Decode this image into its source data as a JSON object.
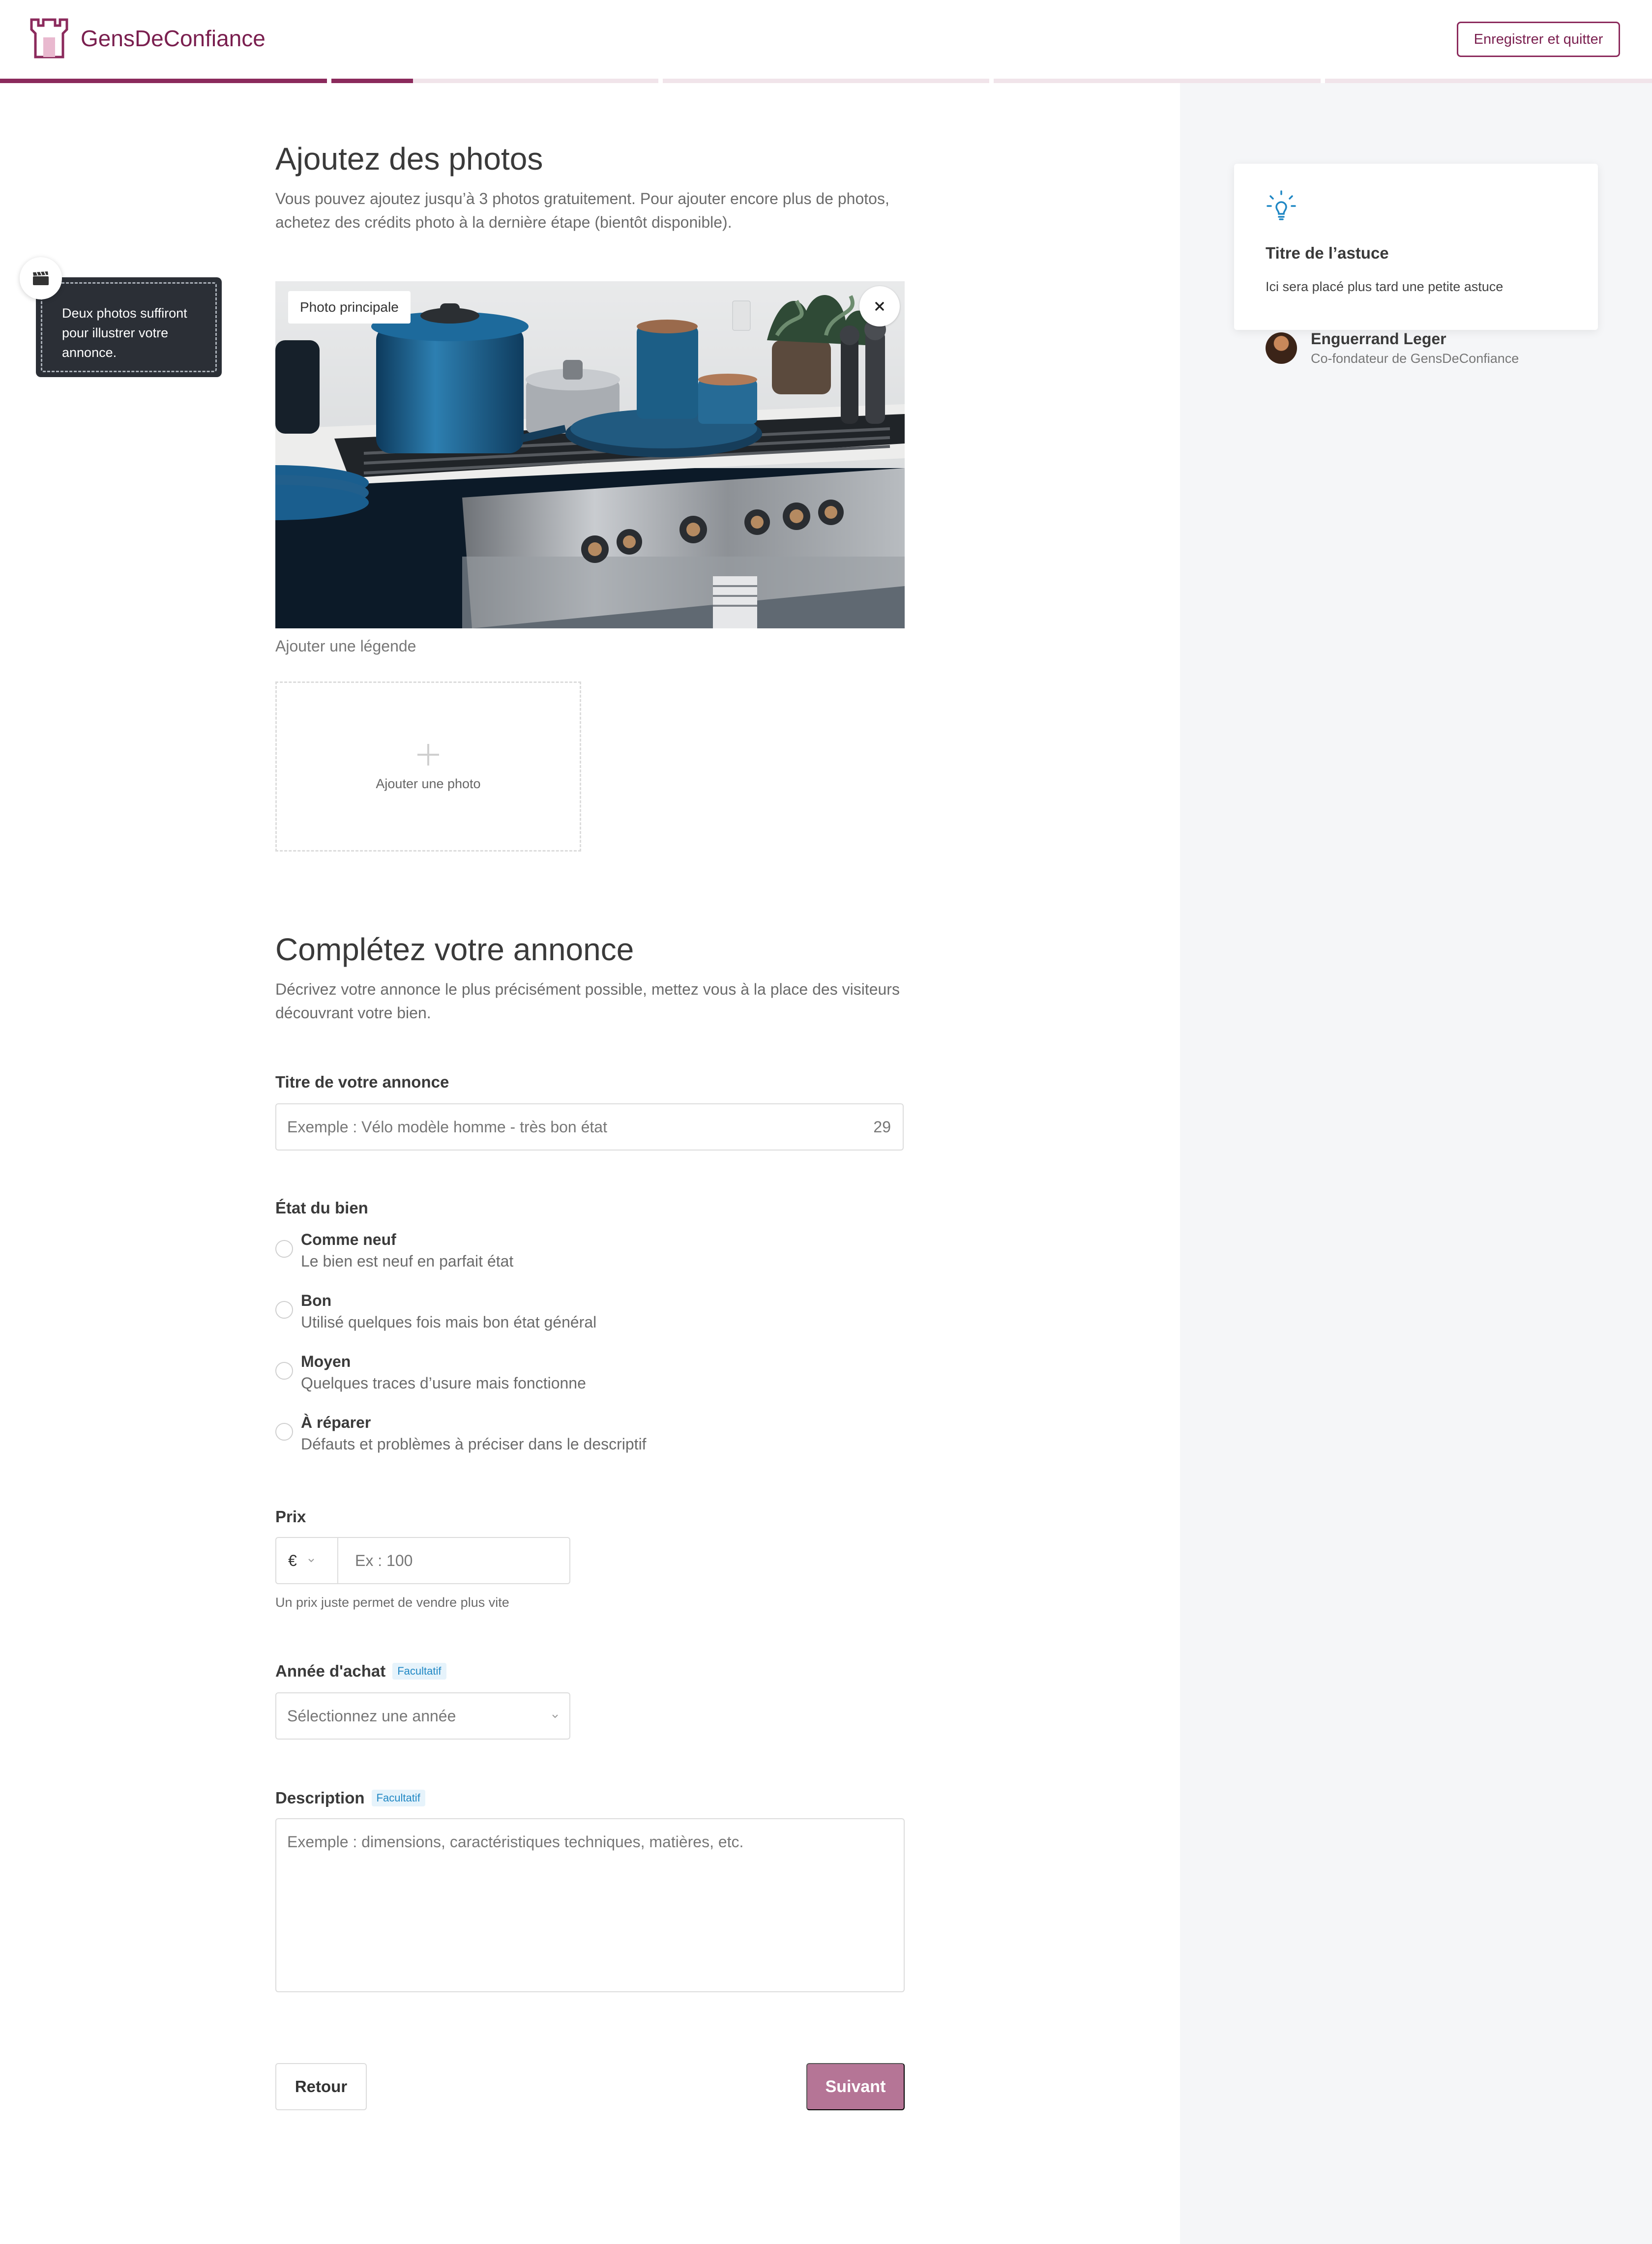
{
  "header": {
    "brand": "GensDeConfiance",
    "save_quit_label": "Enregistrer et quitter"
  },
  "progress": {
    "step_fill": [
      1.0,
      0.25,
      0,
      0,
      0
    ]
  },
  "hint": {
    "text": "Deux photos suffiront pour illustrer votre annonce."
  },
  "photos": {
    "title": "Ajoutez des photos",
    "subtitle": "Vous pouvez ajoutez jusqu’à 3 photos gratuitement. Pour ajouter encore plus de photos, achetez des crédits photo à la dernière étape (bientôt disponible).",
    "main_badge": "Photo principale",
    "caption_placeholder": "Ajouter une légende",
    "add_label": "Ajouter une photo"
  },
  "listing": {
    "title": "Complétez votre annonce",
    "subtitle": "Décrivez votre annonce le plus précisément possible, mettez vous à la place des visiteurs découvrant votre bien."
  },
  "fields": {
    "title_label": "Titre de votre annonce",
    "title_placeholder": "Exemple : Vélo modèle homme - très bon état",
    "title_counter": "29",
    "condition_label": "État du bien",
    "conditions": [
      {
        "title": "Comme neuf",
        "desc": "Le bien est neuf en parfait état"
      },
      {
        "title": "Bon",
        "desc": "Utilisé quelques fois mais bon état général"
      },
      {
        "title": "Moyen",
        "desc": "Quelques traces d’usure mais fonctionne"
      },
      {
        "title": "À réparer",
        "desc": "Défauts et problèmes à préciser dans le descriptif"
      }
    ],
    "price_label": "Prix",
    "currency": "€",
    "price_placeholder": "Ex : 100",
    "price_help": "Un prix juste permet de vendre plus vite",
    "year_label": "Année d'achat",
    "optional_badge": "Facultatif",
    "year_placeholder": "Sélectionnez une année",
    "description_label": "Description",
    "description_placeholder": "Exemple : dimensions, caractéristiques techniques, matières, etc."
  },
  "buttons": {
    "back": "Retour",
    "next": "Suivant"
  },
  "tip": {
    "title": "Titre de l’astuce",
    "text": "Ici sera placé plus tard une petite astuce",
    "author_name": "Enguerrand Leger",
    "author_role": "Co-fondateur de GensDeConfiance"
  },
  "colors": {
    "brand": "#8b2a5c",
    "next_button": "#b57596",
    "tip_icon": "#1f87c4",
    "optional_badge": "#1f87c4"
  }
}
